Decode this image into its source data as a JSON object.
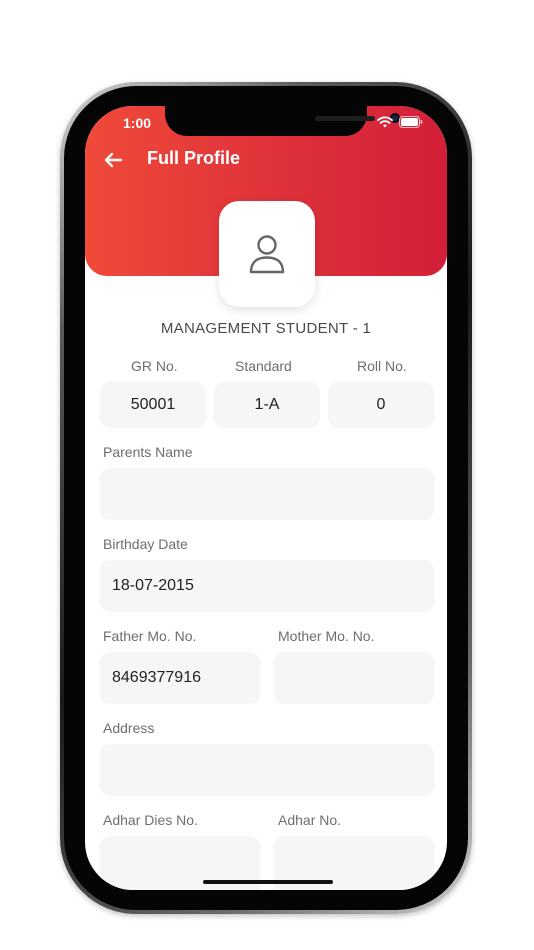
{
  "status_bar": {
    "time": "1:00"
  },
  "header": {
    "title": "Full Profile"
  },
  "student": {
    "name": "MANAGEMENT STUDENT - 1"
  },
  "fields": {
    "gr_no": {
      "label": "GR No.",
      "value": "50001"
    },
    "standard": {
      "label": "Standard",
      "value": "1-A"
    },
    "roll_no": {
      "label": "Roll No.",
      "value": "0"
    },
    "parents_name": {
      "label": "Parents Name",
      "value": ""
    },
    "birthday_date": {
      "label": "Birthday Date",
      "value": "18-07-2015"
    },
    "father_mo_no": {
      "label": "Father Mo. No.",
      "value": "8469377916"
    },
    "mother_mo_no": {
      "label": "Mother Mo. No.",
      "value": ""
    },
    "address": {
      "label": "Address",
      "value": ""
    },
    "adhar_dies_no": {
      "label": "Adhar Dies No.",
      "value": ""
    },
    "adhar_no": {
      "label": "Adhar No.",
      "value": ""
    }
  },
  "colors": {
    "header_start": "#f04a3a",
    "header_end": "#d21f38",
    "field_bg": "#f6f6f6"
  },
  "icons": {
    "back": "arrow-left-icon",
    "avatar": "user-outline-icon"
  }
}
